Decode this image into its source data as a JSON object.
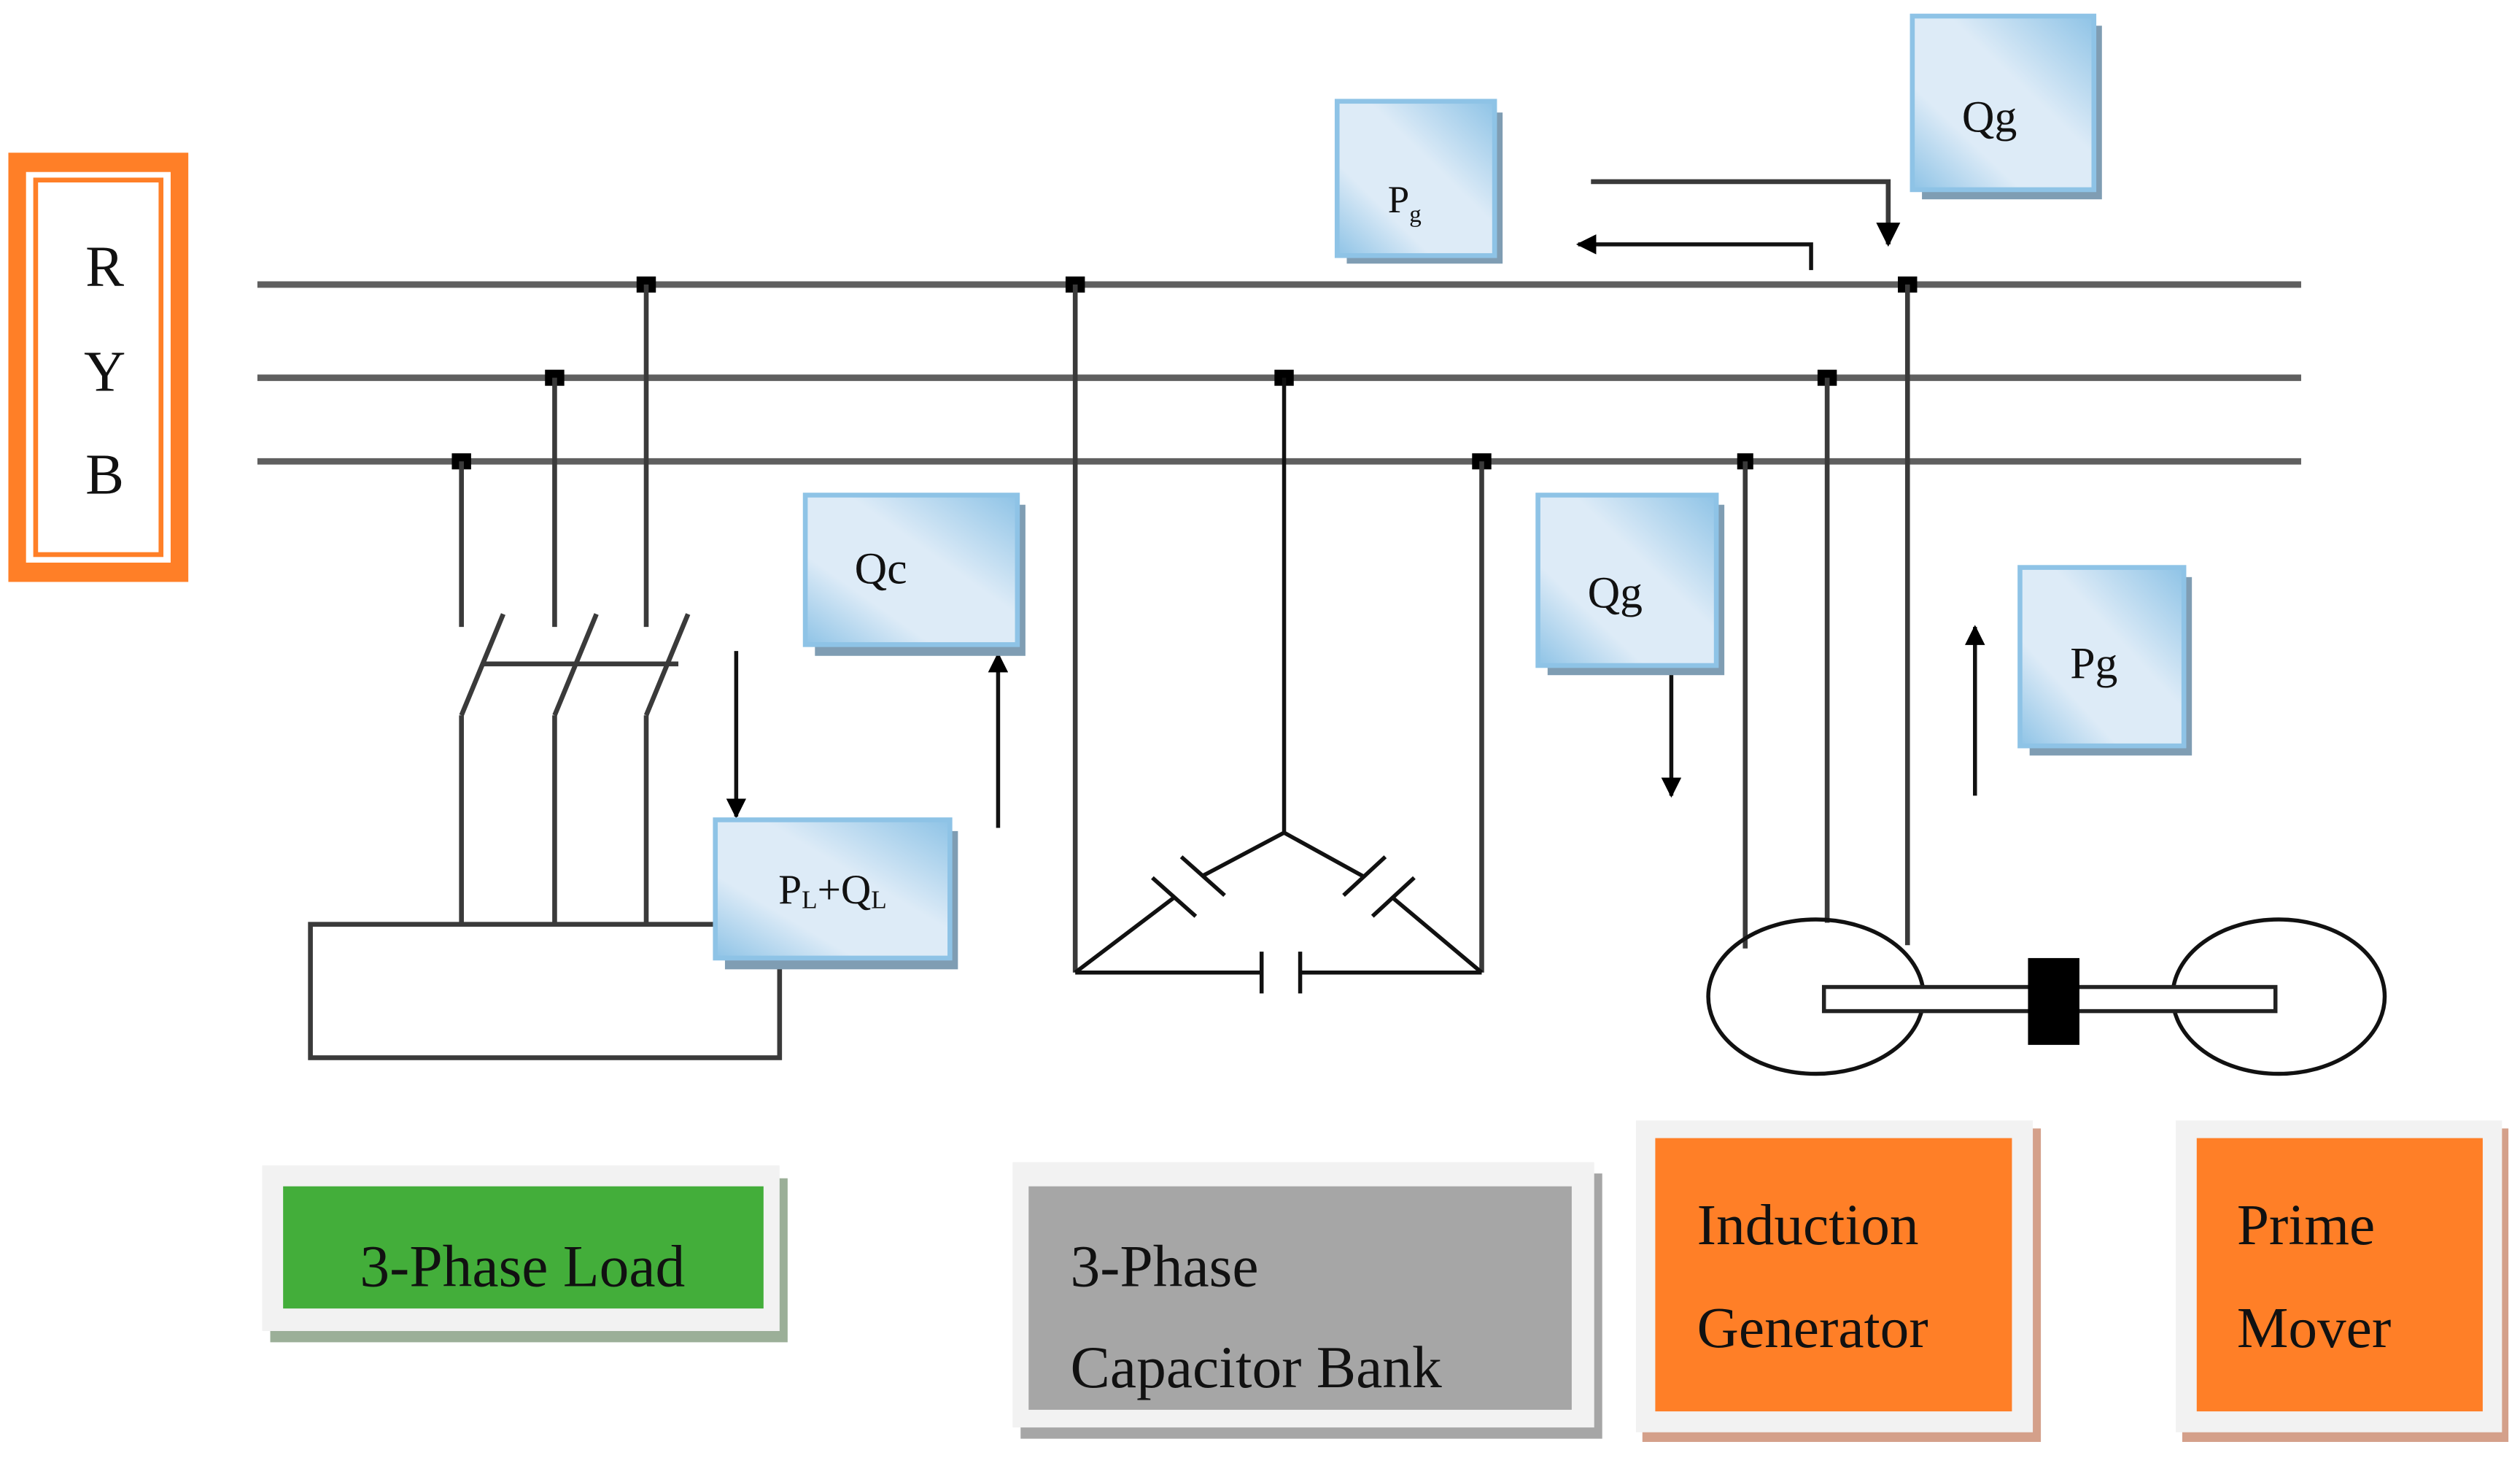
{
  "phase_label": {
    "lines": [
      "R",
      "Y",
      "B"
    ],
    "border_color": "#FF7F27"
  },
  "flow_boxes": {
    "pg_top": {
      "main": "P",
      "sub": "g"
    },
    "qg_top": {
      "text": "Qg"
    },
    "qc": {
      "text": "Qc"
    },
    "pl_ql": {
      "p": "P",
      "p_sub": "L",
      "plus": "+",
      "q": "Q",
      "q_sub": "L"
    },
    "qg_mid": {
      "text": "Qg"
    },
    "pg_right": {
      "text": "Pg"
    },
    "fill_light": "#DDEBF7",
    "fill_edge": "#8EC3E6",
    "shadow": "#7F9DB3"
  },
  "component_labels": {
    "load": {
      "line1": "3-Phase Load",
      "color": "#43AE3A"
    },
    "capacitor_bank": {
      "line1": "3-Phase",
      "line2": "Capacitor Bank",
      "color": "#A6A6A6"
    },
    "induction_generator": {
      "line1": "Induction",
      "line2": "Generator",
      "color": "#FF7F27"
    },
    "prime_mover": {
      "line1": "Prime",
      "line2": "Mover",
      "color": "#FF7F27"
    }
  }
}
